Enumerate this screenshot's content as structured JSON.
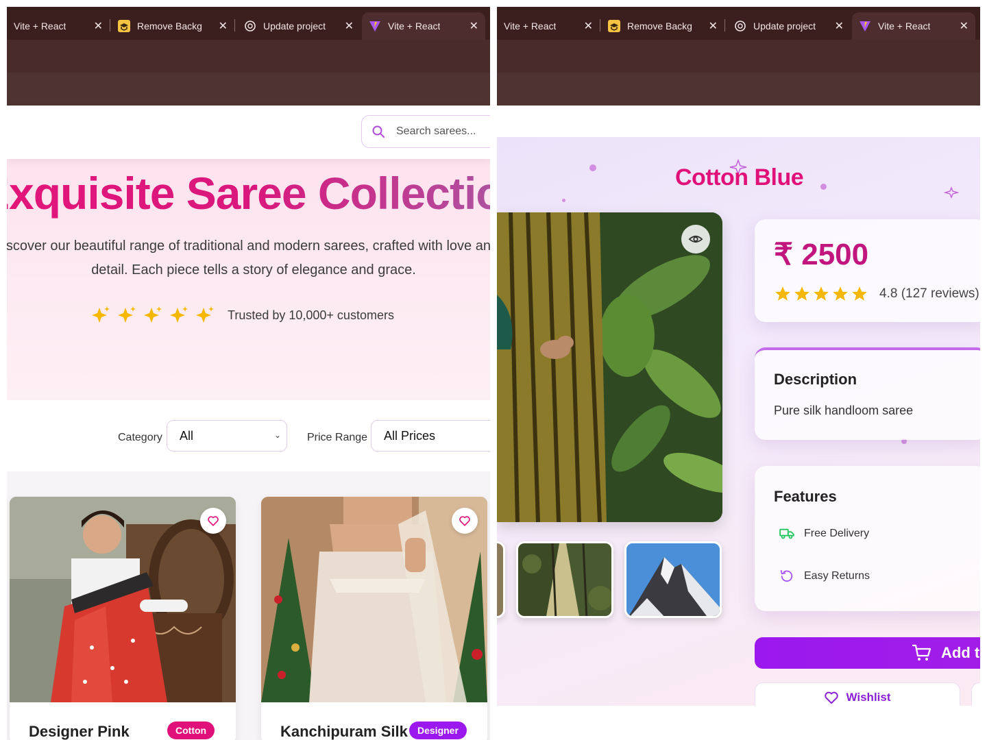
{
  "browser": {
    "tabs": [
      {
        "label": "Vite + React",
        "favicon": "none",
        "active": false
      },
      {
        "label": "Remove Backg",
        "favicon": "remove-bg-favicon",
        "active": false
      },
      {
        "label": "Update project",
        "favicon": "openai-favicon",
        "active": false
      },
      {
        "label": "Vite + React",
        "favicon": "vite-favicon",
        "active": true
      }
    ],
    "close_glyph": "✕"
  },
  "colors": {
    "accent_pink": "#e0127a",
    "accent_purple": "#9b18ee",
    "star_gold": "#f5b800",
    "chrome_dark": "#3b1f1f"
  },
  "left": {
    "search": {
      "placeholder": "Search sarees..."
    },
    "hero": {
      "title": "Exquisite Saree Collection",
      "subtitle_line1": "Discover our beautiful range of traditional and modern sarees, crafted with love and attention to",
      "subtitle_line2": "detail. Each piece tells a story of elegance and grace.",
      "trust_text": "Trusted by 10,000+ customers",
      "star_count": 5
    },
    "filters": {
      "category_label": "Category",
      "category_value": "All",
      "price_label": "Price Range",
      "price_value": "All Prices"
    },
    "products": [
      {
        "name": "Designer Pink",
        "badge": "Cotton",
        "badge_color": "#e0127a"
      },
      {
        "name": "Kanchipuram Silk",
        "badge": "Designer",
        "badge_color": "#9b18ee"
      }
    ]
  },
  "right": {
    "title": "Cotton Blue",
    "price": "₹ 2500",
    "rating": {
      "stars": 5,
      "text": "4.8 (127 reviews)"
    },
    "description": {
      "heading": "Description",
      "text": "Pure silk handloom saree"
    },
    "features": {
      "heading": "Features",
      "items": [
        {
          "label": "Free Delivery",
          "icon": "truck-icon"
        },
        {
          "label": "Easy Returns",
          "icon": "rotate-ccw-icon"
        }
      ]
    },
    "cart_label": "Add to Cart",
    "wishlist_label": "Wishlist"
  }
}
